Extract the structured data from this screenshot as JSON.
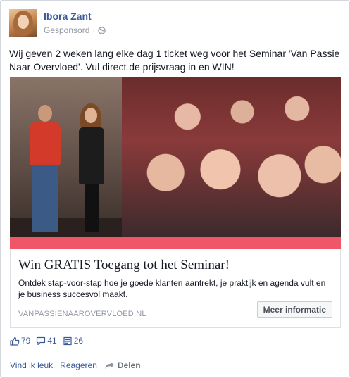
{
  "post": {
    "author": "Ibora Zant",
    "sponsored_label": "Gesponsord",
    "separator": "·",
    "message": "Wij geven 2 weken lang elke dag 1 ticket weg voor het Seminar 'Van Passie Naar Overvloed'. Vul direct de prijsvraag in en WIN!"
  },
  "ad": {
    "title": "Win GRATIS Toegang tot het Seminar!",
    "description": "Ontdek stap-voor-stap hoe je goede klanten aantrekt, je praktijk en agenda vult en je business succesvol maakt.",
    "domain": "VANPASSIENAAROVERVLOED.NL",
    "cta_label": "Meer informatie",
    "accent_color": "#ef5667"
  },
  "counts": {
    "likes": "79",
    "comments": "41",
    "shares": "26"
  },
  "actions": {
    "like_label": "Vind ik leuk",
    "comment_label": "Reageren",
    "share_label": "Delen"
  },
  "colors": {
    "link": "#3b5998",
    "muted": "#9197a3",
    "text": "#141823"
  },
  "icons": {
    "globe": "globe-icon",
    "like": "thumbs-up-icon",
    "comment": "comment-icon",
    "share_count": "share-count-icon",
    "share_action": "share-arrow-icon"
  }
}
